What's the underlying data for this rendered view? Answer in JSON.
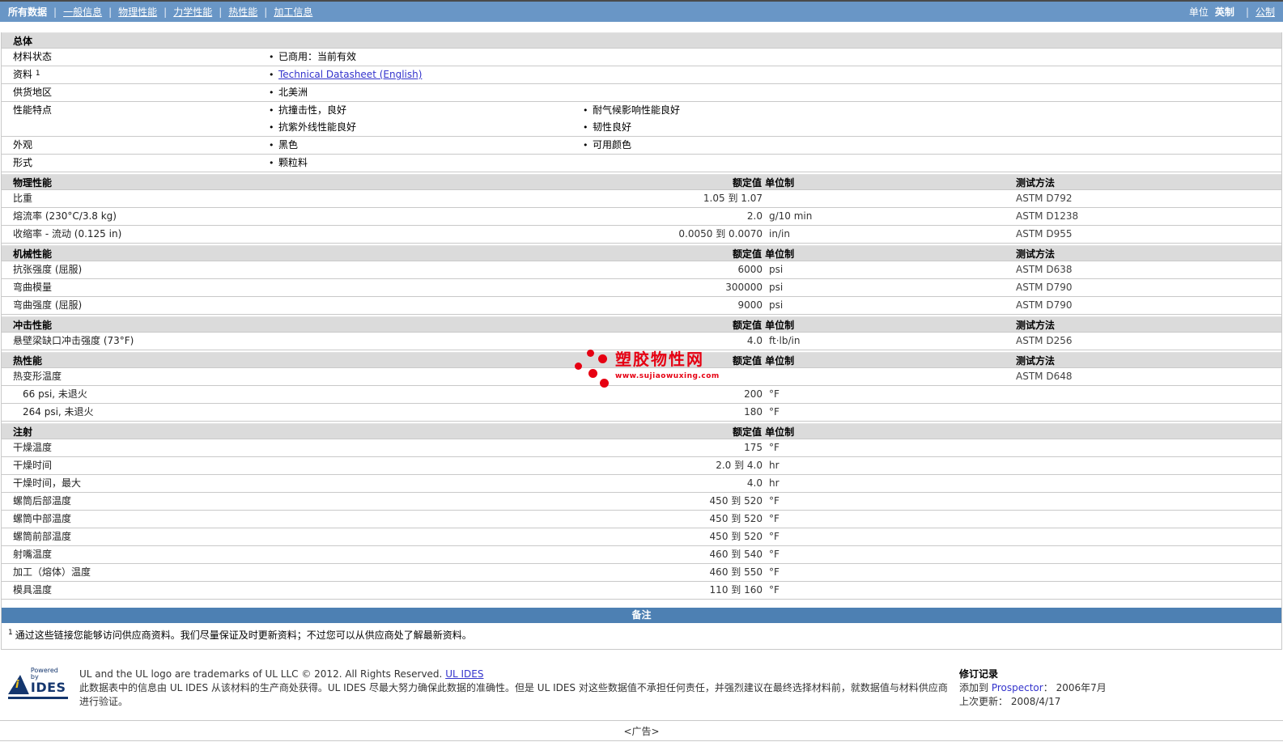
{
  "colors": {
    "nav-bg": "#6996C6",
    "banner-bg": "#4D80B3",
    "header-bg": "#DBDBDB",
    "link": "#3333CC",
    "wm-red": "#E60012",
    "border": "#C9C9C9"
  },
  "nav": {
    "items": [
      {
        "label": "所有数据",
        "active": true
      },
      {
        "label": "一般信息",
        "active": false
      },
      {
        "label": "物理性能",
        "active": false
      },
      {
        "label": "力学性能",
        "active": false
      },
      {
        "label": "热性能",
        "active": false
      },
      {
        "label": "加工信息",
        "active": false
      }
    ],
    "units_label": "单位",
    "units_active": "英制",
    "units_link": "公制"
  },
  "general": {
    "title": "总体",
    "rows": [
      {
        "label": "材料状态",
        "items1": [
          {
            "text": "已商用：当前有效",
            "link": false
          }
        ],
        "items2": []
      },
      {
        "label": "资料",
        "sup": "1",
        "items1": [
          {
            "text": "Technical Datasheet (English)",
            "link": true
          }
        ],
        "items2": []
      },
      {
        "label": "供货地区",
        "items1": [
          {
            "text": "北美洲",
            "link": false
          }
        ],
        "items2": []
      },
      {
        "label": "性能特点",
        "items1": [
          {
            "text": "抗撞击性，良好",
            "link": false
          },
          {
            "text": "抗紫外线性能良好",
            "link": false
          }
        ],
        "items2": [
          {
            "text": "耐气候影响性能良好",
            "link": false
          },
          {
            "text": "韧性良好",
            "link": false
          }
        ]
      },
      {
        "label": "外观",
        "items1": [
          {
            "text": "黑色",
            "link": false
          }
        ],
        "items2": [
          {
            "text": "可用颜色",
            "link": false
          }
        ]
      },
      {
        "label": "形式",
        "items1": [
          {
            "text": "颗粒料",
            "link": false
          }
        ],
        "items2": []
      }
    ]
  },
  "sections": [
    {
      "title": "物理性能",
      "value_unit_header": "额定值 单位制",
      "method_header": "测试方法",
      "rows": [
        {
          "label": "比重",
          "value": "1.05 到 1.07",
          "unit": "",
          "method": "ASTM D792",
          "indent": false
        },
        {
          "label": "熔流率 (230°C/3.8 kg)",
          "value": "2.0",
          "unit": "g/10 min",
          "method": "ASTM D1238",
          "indent": false
        },
        {
          "label": "收缩率 - 流动 (0.125 in)",
          "value": "0.0050 到 0.0070",
          "unit": "in/in",
          "method": "ASTM D955",
          "indent": false
        }
      ]
    },
    {
      "title": "机械性能",
      "value_unit_header": "额定值 单位制",
      "method_header": "测试方法",
      "rows": [
        {
          "label": "抗张强度 (屈服)",
          "value": "6000",
          "unit": "psi",
          "method": "ASTM D638",
          "indent": false
        },
        {
          "label": "弯曲模量",
          "value": "300000",
          "unit": "psi",
          "method": "ASTM D790",
          "indent": false
        },
        {
          "label": "弯曲强度 (屈服)",
          "value": "9000",
          "unit": "psi",
          "method": "ASTM D790",
          "indent": false
        }
      ]
    },
    {
      "title": "冲击性能",
      "value_unit_header": "额定值 单位制",
      "method_header": "测试方法",
      "rows": [
        {
          "label": "悬壁梁缺口冲击强度 (73°F)",
          "value": "4.0",
          "unit": "ft·lb/in",
          "method": "ASTM D256",
          "indent": false
        }
      ]
    },
    {
      "title": "热性能",
      "value_unit_header": "额定值 单位制",
      "method_header": "测试方法",
      "rows": [
        {
          "label": "热变形温度",
          "value": "",
          "unit": "",
          "method": "ASTM D648",
          "indent": false
        },
        {
          "label": "66 psi, 未退火",
          "value": "200",
          "unit": "°F",
          "method": "",
          "indent": true
        },
        {
          "label": "264 psi, 未退火",
          "value": "180",
          "unit": "°F",
          "method": "",
          "indent": true
        }
      ]
    },
    {
      "title": "注射",
      "value_unit_header": "额定值 单位制",
      "method_header": "",
      "rows": [
        {
          "label": "干燥温度",
          "value": "175",
          "unit": "°F",
          "method": "",
          "indent": false
        },
        {
          "label": "干燥时间",
          "value": "2.0 到 4.0",
          "unit": "hr",
          "method": "",
          "indent": false
        },
        {
          "label": "干燥时间，最大",
          "value": "4.0",
          "unit": "hr",
          "method": "",
          "indent": false
        },
        {
          "label": "螺筒后部温度",
          "value": "450 到 520",
          "unit": "°F",
          "method": "",
          "indent": false
        },
        {
          "label": "螺筒中部温度",
          "value": "450 到 520",
          "unit": "°F",
          "method": "",
          "indent": false
        },
        {
          "label": "螺筒前部温度",
          "value": "450 到 520",
          "unit": "°F",
          "method": "",
          "indent": false
        },
        {
          "label": "射嘴温度",
          "value": "460 到 540",
          "unit": "°F",
          "method": "",
          "indent": false
        },
        {
          "label": "加工（熔体）温度",
          "value": "460 到 550",
          "unit": "°F",
          "method": "",
          "indent": false
        },
        {
          "label": "模具温度",
          "value": "110 到 160",
          "unit": "°F",
          "method": "",
          "indent": false
        }
      ]
    }
  ],
  "notes": {
    "banner": "备注",
    "footnote_marker": "1",
    "footnote_text": "通过这些链接您能够访问供应商资料。我们尽量保证及时更新资料；不过您可以从供应商处了解最新资料。"
  },
  "watermark": {
    "title": "塑胶物性网",
    "url": "www.sujiaowuxing.com"
  },
  "footer": {
    "logo": {
      "powered_by": "Powered by",
      "name": "IDES"
    },
    "line1": "UL and the UL logo are trademarks of UL LLC © 2012. All Rights Reserved.",
    "line1_link": "UL IDES",
    "line2": "此数据表中的信息由 UL IDES 从该材料的生产商处获得。UL IDES 尽最大努力确保此数据的准确性。但是 UL IDES 对这些数据值不承担任何责任，并强烈建议在最终选择材料前，就数据值与材料供应商进行验证。",
    "revision": {
      "title": "修订记录",
      "added_label": "添加到",
      "added_link": "Prospector",
      "added_sep": "：",
      "added_value": "2006年7月",
      "updated_label": "上次更新：",
      "updated_value": "2008/4/17"
    }
  },
  "ad": "<广告>"
}
